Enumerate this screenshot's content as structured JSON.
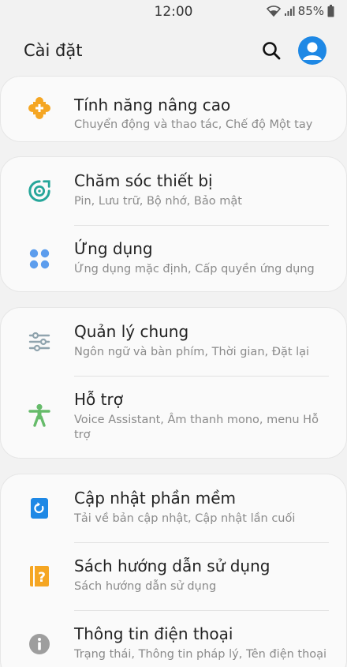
{
  "status_bar": {
    "time": "12:00",
    "battery": "85%"
  },
  "header": {
    "title": "Cài đặt"
  },
  "items": [
    {
      "title": "Tính năng nâng cao",
      "subtitle": "Chuyển động và thao tác, Chế độ Một tay",
      "icon": "puzzle-plus-icon",
      "color": "#f5a623"
    },
    {
      "title": "Chăm sóc thiết bị",
      "subtitle": "Pin, Lưu trữ, Bộ nhớ, Bảo mật",
      "icon": "device-care-icon",
      "color": "#26a69a"
    },
    {
      "title": "Ứng dụng",
      "subtitle": "Ứng dụng mặc định, Cấp quyền ứng dụng",
      "icon": "apps-grid-icon",
      "color": "#5c9ded"
    },
    {
      "title": "Quản lý chung",
      "subtitle": "Ngôn ngữ và bàn phím, Thời gian, Đặt lại",
      "icon": "sliders-icon",
      "color": "#90a4ae"
    },
    {
      "title": "Hỗ trợ",
      "subtitle": "Voice Assistant, Âm thanh mono, menu Hỗ",
      "subtitle2": "trợ",
      "icon": "accessibility-icon",
      "color": "#66bb6a"
    },
    {
      "title": "Cập nhật phần mềm",
      "subtitle": "Tải về bản cập nhật, Cập nhật lần cuối",
      "icon": "software-update-icon",
      "color": "#1e88e5"
    },
    {
      "title": "Sách hướng dẫn sử dụng",
      "subtitle": "Sách hướng dẫn sử dụng",
      "icon": "user-manual-icon",
      "color": "#f5a623"
    },
    {
      "title": "Thông tin điện thoại",
      "subtitle": "Trạng thái, Thông tin pháp lý, Tên điện thoại",
      "icon": "info-icon",
      "color": "#9e9e9e"
    }
  ]
}
